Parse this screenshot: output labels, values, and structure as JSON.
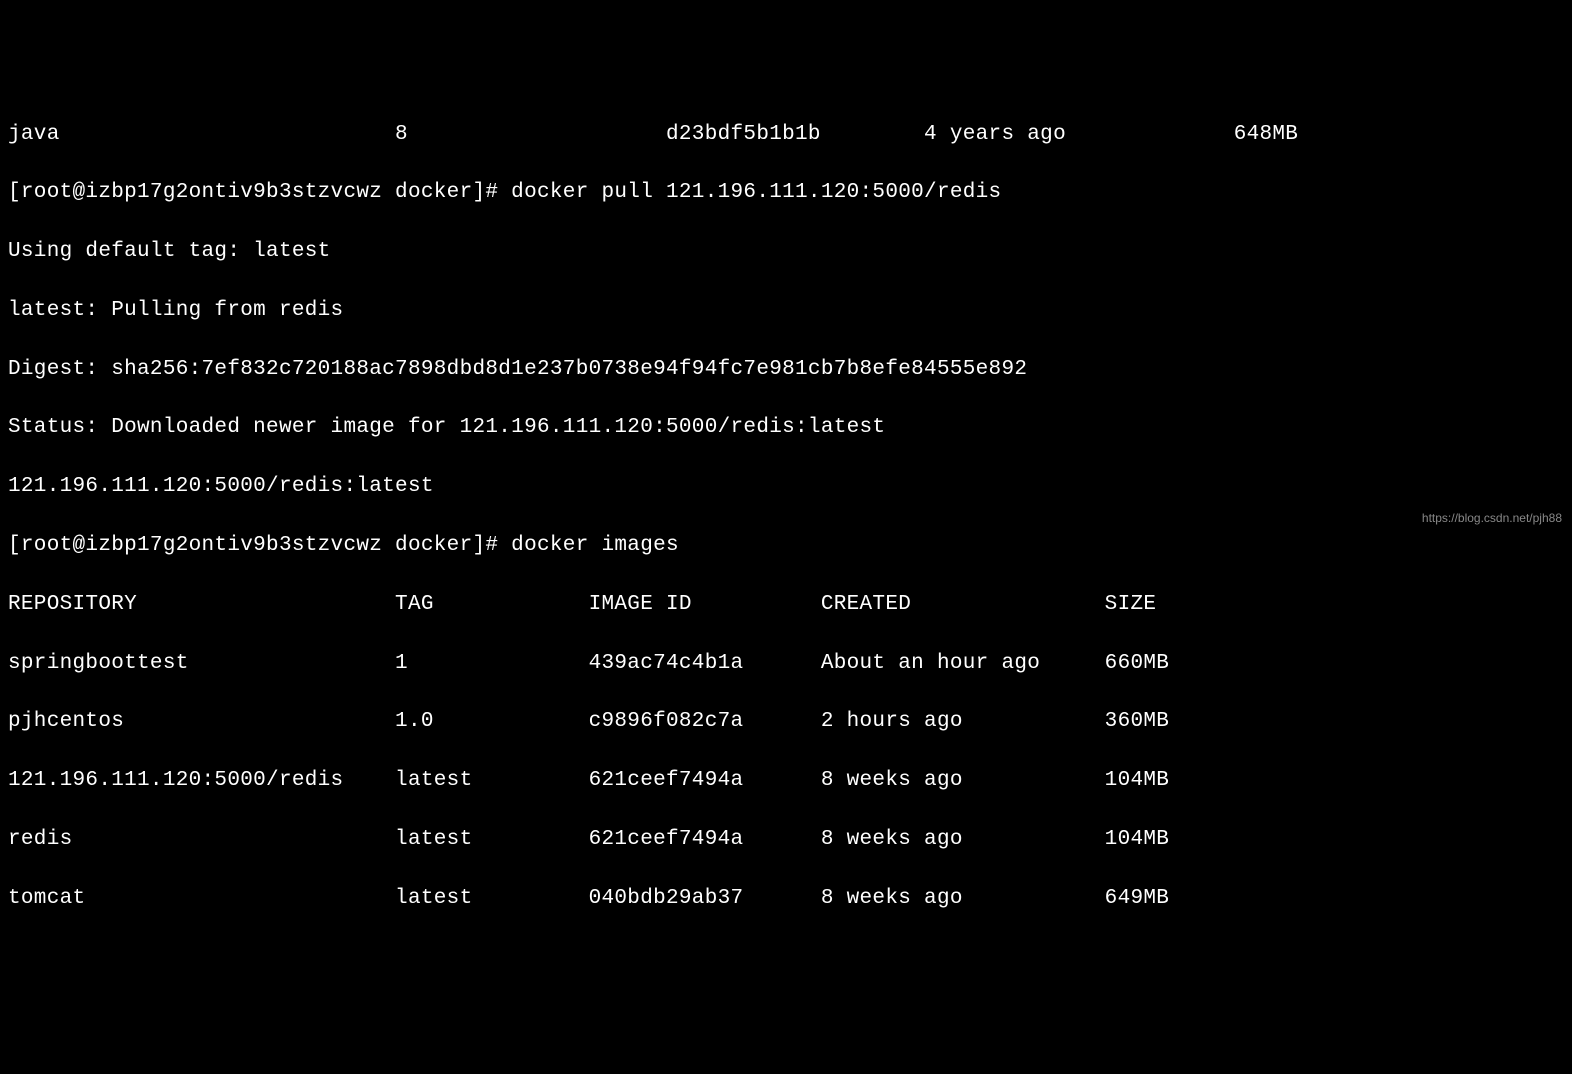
{
  "lines": {
    "l0": "java                          8                    d23bdf5b1b1b        4 years ago             648MB",
    "l1": "[root@izbp17g2ontiv9b3stzvcwz docker]# docker pull 121.196.111.120:5000/redis",
    "l2": "Using default tag: latest",
    "l3": "latest: Pulling from redis",
    "l4": "Digest: sha256:7ef832c720188ac7898dbd8d1e237b0738e94f94fc7e981cb7b8efe84555e892",
    "l5": "Status: Downloaded newer image for 121.196.111.120:5000/redis:latest",
    "l6": "121.196.111.120:5000/redis:latest",
    "l7": "[root@izbp17g2ontiv9b3stzvcwz docker]# docker images",
    "l8": "REPOSITORY                    TAG            IMAGE ID          CREATED               SIZE",
    "l9": "springboottest                1              439ac74c4b1a      About an hour ago     660MB",
    "l10": "pjhcentos                     1.0            c9896f082c7a      2 hours ago           360MB",
    "l11": "121.196.111.120:5000/redis    latest         621ceef7494a      8 weeks ago           104MB",
    "l12": "redis                         latest         621ceef7494a      8 weeks ago           104MB",
    "l13": "tomcat                        latest         040bdb29ab37      8 weeks ago           649MB"
  },
  "watermark": "https://blog.csdn.net/pjh88"
}
